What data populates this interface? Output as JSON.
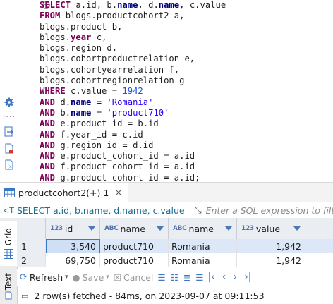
{
  "editor": {
    "lines": [
      [
        {
          "t": "SELECT",
          "c": "kw"
        },
        {
          "t": " a.id, b.",
          "c": "plain"
        },
        {
          "t": "name",
          "c": "kwn"
        },
        {
          "t": ", d.",
          "c": "plain"
        },
        {
          "t": "name",
          "c": "kwn"
        },
        {
          "t": ", c.value",
          "c": "plain"
        }
      ],
      [
        {
          "t": "FROM",
          "c": "kw"
        },
        {
          "t": " blogs.productcohort2 a,",
          "c": "plain"
        }
      ],
      [
        {
          "t": "blogs.product b,",
          "c": "plain"
        }
      ],
      [
        {
          "t": "blogs.",
          "c": "plain"
        },
        {
          "t": "year",
          "c": "kw"
        },
        {
          "t": " c,",
          "c": "plain"
        }
      ],
      [
        {
          "t": "blogs.region d,",
          "c": "plain"
        }
      ],
      [
        {
          "t": "blogs.cohortproductrelation e,",
          "c": "plain"
        }
      ],
      [
        {
          "t": "blogs.cohortyearrelation f,",
          "c": "plain"
        }
      ],
      [
        {
          "t": "blogs.cohortregionrelation g",
          "c": "plain"
        }
      ],
      [
        {
          "t": "WHERE",
          "c": "kw"
        },
        {
          "t": " c.value = ",
          "c": "plain"
        },
        {
          "t": "1942",
          "c": "num"
        }
      ],
      [
        {
          "t": "AND",
          "c": "kw"
        },
        {
          "t": " d.",
          "c": "plain"
        },
        {
          "t": "name",
          "c": "kwn"
        },
        {
          "t": " = ",
          "c": "plain"
        },
        {
          "t": "'Romania'",
          "c": "str"
        }
      ],
      [
        {
          "t": "AND",
          "c": "kw"
        },
        {
          "t": " b.",
          "c": "plain"
        },
        {
          "t": "name",
          "c": "kwn"
        },
        {
          "t": " = ",
          "c": "plain"
        },
        {
          "t": "'product710'",
          "c": "str"
        }
      ],
      [
        {
          "t": "AND",
          "c": "kw"
        },
        {
          "t": " e.product_id = b.id",
          "c": "plain"
        }
      ],
      [
        {
          "t": "AND",
          "c": "kw"
        },
        {
          "t": " f.year_id = c.id",
          "c": "plain"
        }
      ],
      [
        {
          "t": "AND",
          "c": "kw"
        },
        {
          "t": " g.region_id = d.id",
          "c": "plain"
        }
      ],
      [
        {
          "t": "AND",
          "c": "kw"
        },
        {
          "t": " e.product_cohort_id = a.id",
          "c": "plain"
        }
      ],
      [
        {
          "t": "AND",
          "c": "kw"
        },
        {
          "t": " f.product_cohort_id = a.id",
          "c": "plain"
        }
      ],
      [
        {
          "t": "AND",
          "c": "kw"
        },
        {
          "t": " g.product_cohort_id = a.id;",
          "c": "plain"
        }
      ]
    ],
    "gutter_dots": "....",
    "fold_symbol": "−"
  },
  "results_tab": {
    "label": "productcohort2(+) 1",
    "close": "✕"
  },
  "filter": {
    "query_text": "SELECT a.id, b.name, d.name, c.value",
    "expression_placeholder": "Enter a SQL expression to filter"
  },
  "side_tabs": {
    "grid": "Grid",
    "text": "Text"
  },
  "grid": {
    "columns": [
      {
        "type_icon": "123",
        "label": "id"
      },
      {
        "type_icon": "ABC",
        "label": "name"
      },
      {
        "type_icon": "ABC",
        "label": "name"
      },
      {
        "type_icon": "123",
        "label": "value"
      }
    ],
    "rows": [
      {
        "num": "1",
        "id": "3,540",
        "name1": "product710",
        "name2": "Romania",
        "value": "1,942"
      },
      {
        "num": "2",
        "id": "69,750",
        "name1": "product710",
        "name2": "Romania",
        "value": "1,942"
      }
    ]
  },
  "toolbar": {
    "refresh": "Refresh",
    "save": "Save",
    "cancel": "Cancel"
  },
  "status": {
    "text": "2 row(s) fetched - 84ms, on 2023-09-07 at 09:11:53"
  },
  "colors": {
    "keyword": "#7f0055",
    "string": "#2a00ff",
    "number": "#1750eb",
    "accent": "#3c78c3",
    "selected_row": "#dce8f7"
  }
}
